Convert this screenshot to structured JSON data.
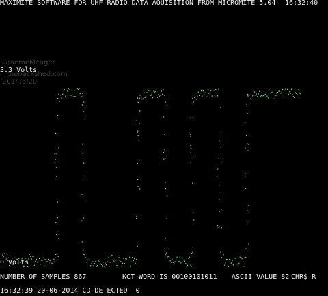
{
  "header": {
    "title": "MAXIMITE SOFTWARE FOR UHF RADIO DATA AQUISITION FROM MICROMITE 5.04",
    "time": "16:32:40"
  },
  "scale": {
    "top_label": "3.3 Volts",
    "bottom_label": "0 Volts"
  },
  "watermark": {
    "name": "GraemeMeager",
    "site": "thebackshed.com",
    "date": "2014/6/20"
  },
  "stats": {
    "samples": "NUMBER OF SAMPLES 867",
    "kct_word": "KCT WORD IS 00100101011",
    "ascii_value": "ASCII VALUE 82",
    "chr": "CHR$ R"
  },
  "status": {
    "line": "16:32:39 20-06-2014 CD DETECTED  0"
  },
  "colors": {
    "background": "#000000",
    "text": "#f2f2f2",
    "trace": "#5fd35f"
  },
  "chart_data": {
    "type": "scatter",
    "ylim": [
      0,
      3.3
    ],
    "xlabel": "",
    "ylabel": "",
    "bit_word": "00100101011",
    "levels": {
      "high": 3.0,
      "low": 0.1
    }
  }
}
